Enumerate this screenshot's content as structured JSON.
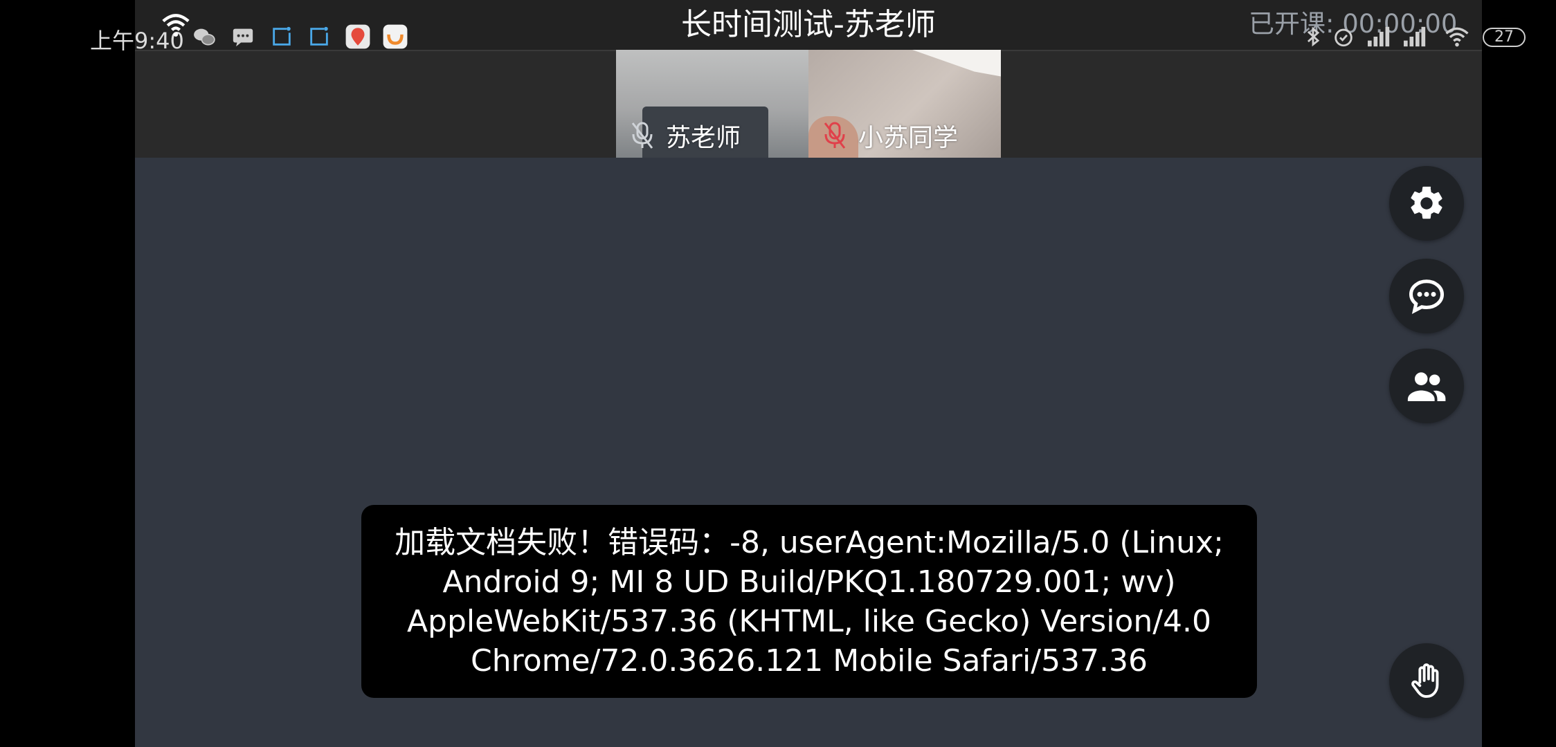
{
  "status_bar": {
    "time": "上午9:40",
    "battery_level": "27",
    "left_icons": [
      "wifi-hotspot-icon",
      "wechat-icon",
      "sms-icon",
      "screen-record-icon",
      "screen-record-icon",
      "didi-map-icon",
      "didi-app-icon"
    ],
    "right_icons": [
      "bluetooth-icon",
      "alarm-icon",
      "signal-icon",
      "signal-icon",
      "wifi-icon",
      "battery-icon"
    ]
  },
  "header": {
    "title": "长时间测试-苏老师",
    "timer_label": "已开课:",
    "timer_value": "00:00:00"
  },
  "videos": [
    {
      "name": "苏老师",
      "mic_state": "muted",
      "mic_color": "#cfd3d8"
    },
    {
      "name": "小苏同学",
      "mic_state": "muted",
      "mic_color": "#e0404a"
    }
  ],
  "side_controls": [
    "settings",
    "chat",
    "members",
    "raise-hand"
  ],
  "error": {
    "message": "加载文档失败！错误码：-8, userAgent:Mozilla/5.0 (Linux; Android 9; MI 8 UD Build/PKQ1.180729.001; wv) AppleWebKit/537.36 (KHTML, like Gecko) Version/4.0 Chrome/72.0.3626.121 Mobile Safari/537.36"
  },
  "colors": {
    "app_background": "#323741",
    "header_background": "#2a2a2a",
    "toast_background": "#000000",
    "button_background": "#1f2226"
  }
}
